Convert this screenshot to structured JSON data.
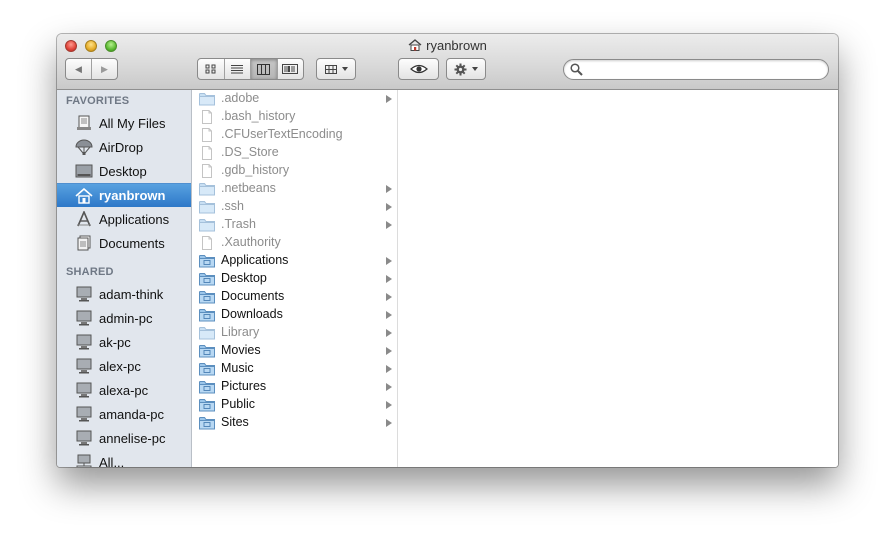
{
  "window": {
    "title": "ryanbrown"
  },
  "toolbar": {
    "back_glyph": "◀",
    "forward_glyph": "▶",
    "views": [
      "icon-view",
      "list-view",
      "column-view",
      "coverflow-view"
    ],
    "active_view": "column-view",
    "search_placeholder": ""
  },
  "sidebar": {
    "favorites_header": "FAVORITES",
    "favorites": [
      {
        "label": "All My Files",
        "icon": "all-files-icon"
      },
      {
        "label": "AirDrop",
        "icon": "airdrop-icon"
      },
      {
        "label": "Desktop",
        "icon": "desktop-icon"
      },
      {
        "label": "ryanbrown",
        "icon": "home-icon",
        "selected": true
      },
      {
        "label": "Applications",
        "icon": "applications-icon"
      },
      {
        "label": "Documents",
        "icon": "documents-icon"
      }
    ],
    "shared_header": "SHARED",
    "shared": [
      {
        "label": "adam-think"
      },
      {
        "label": "admin-pc"
      },
      {
        "label": "ak-pc"
      },
      {
        "label": "alex-pc"
      },
      {
        "label": "alexa-pc"
      },
      {
        "label": "amanda-pc"
      },
      {
        "label": "annelise-pc"
      },
      {
        "label": "All..."
      }
    ]
  },
  "files": [
    {
      "name": ".adobe",
      "kind": "folder",
      "hidden": true,
      "arrow": true
    },
    {
      "name": ".bash_history",
      "kind": "file",
      "hidden": true,
      "arrow": false
    },
    {
      "name": ".CFUserTextEncoding",
      "kind": "file",
      "hidden": true,
      "arrow": false
    },
    {
      "name": ".DS_Store",
      "kind": "file",
      "hidden": true,
      "arrow": false
    },
    {
      "name": ".gdb_history",
      "kind": "file",
      "hidden": true,
      "arrow": false
    },
    {
      "name": ".netbeans",
      "kind": "folder",
      "hidden": true,
      "arrow": true
    },
    {
      "name": ".ssh",
      "kind": "folder",
      "hidden": true,
      "arrow": true
    },
    {
      "name": ".Trash",
      "kind": "folder",
      "hidden": true,
      "arrow": true
    },
    {
      "name": ".Xauthority",
      "kind": "file",
      "hidden": true,
      "arrow": false
    },
    {
      "name": "Applications",
      "kind": "folder",
      "hidden": false,
      "arrow": true
    },
    {
      "name": "Desktop",
      "kind": "folder",
      "hidden": false,
      "arrow": true
    },
    {
      "name": "Documents",
      "kind": "folder",
      "hidden": false,
      "arrow": true
    },
    {
      "name": "Downloads",
      "kind": "folder",
      "hidden": false,
      "arrow": true
    },
    {
      "name": "Library",
      "kind": "folder",
      "hidden": true,
      "arrow": true
    },
    {
      "name": "Movies",
      "kind": "folder",
      "hidden": false,
      "arrow": true
    },
    {
      "name": "Music",
      "kind": "folder",
      "hidden": false,
      "arrow": true
    },
    {
      "name": "Pictures",
      "kind": "folder",
      "hidden": false,
      "arrow": true
    },
    {
      "name": "Public",
      "kind": "folder",
      "hidden": false,
      "arrow": true
    },
    {
      "name": "Sites",
      "kind": "folder",
      "hidden": false,
      "arrow": true
    }
  ],
  "colors": {
    "selection": "#3a86d4",
    "sidebar_bg": "#e1e6ed",
    "folder_blue": "#7fb5e3"
  }
}
